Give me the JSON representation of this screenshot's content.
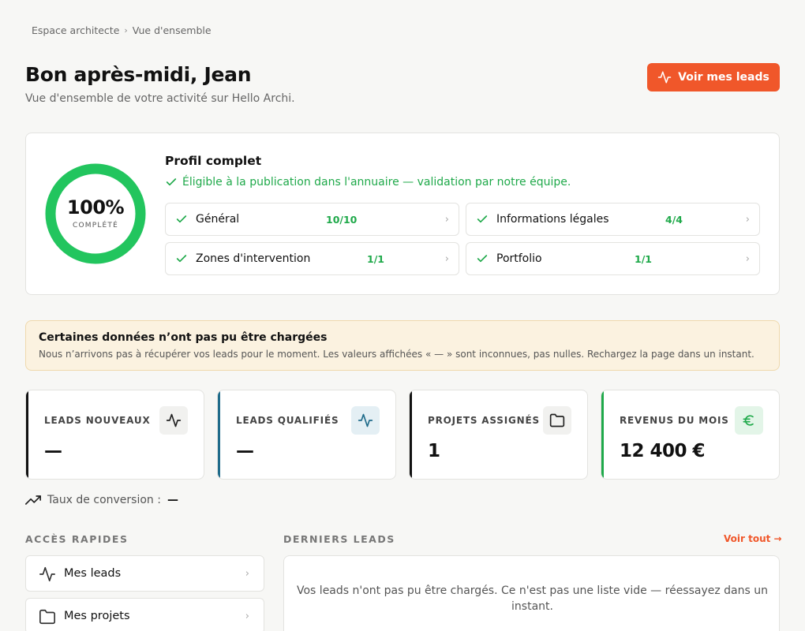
{
  "breadcrumb": {
    "items": [
      "Espace architecte",
      "Vue d'ensemble"
    ]
  },
  "header": {
    "title": "Bon après-midi, Jean",
    "subtitle": "Vue d'ensemble de votre activité sur Hello Archi.",
    "cta_label": "Voir mes leads"
  },
  "profile": {
    "progress_percent": 100,
    "percent_label": "100%",
    "percent_caption": "COMPLÉTÉ",
    "title": "Profil complet",
    "status": "Éligible à la publication dans l'annuaire — validation par notre équipe.",
    "sections": [
      {
        "name": "Général",
        "count": "10/10"
      },
      {
        "name": "Informations légales",
        "count": "4/4"
      },
      {
        "name": "Zones d'intervention",
        "count": "1/1"
      },
      {
        "name": "Portfolio",
        "count": "1/1"
      }
    ]
  },
  "warning": {
    "title": "Certaines données n’ont pas pu être chargées",
    "text": "Nous n’arrivons pas à récupérer vos leads pour le moment. Les valeurs affichées « — » sont inconnues, pas nulles. Rechargez la page dans un instant."
  },
  "stats": [
    {
      "label": "LEADS NOUVEAUX",
      "value": "—",
      "icon": "activity-icon",
      "accent": "#111111"
    },
    {
      "label": "LEADS QUALIFIÉS",
      "value": "—",
      "icon": "activity-icon",
      "accent": "#1f6b8a"
    },
    {
      "label": "PROJETS ASSIGNÉS",
      "value": "1",
      "icon": "folder-icon",
      "accent": "#111111"
    },
    {
      "label": "REVENUS DU MOIS",
      "value": "12 400 €",
      "icon": "euro-icon",
      "accent": "#1fa94a"
    }
  ],
  "conversion": {
    "label": "Taux de conversion :",
    "value": "—"
  },
  "quick_access": {
    "title": "ACCÈS RAPIDES",
    "items": [
      {
        "label": "Mes leads",
        "icon": "activity-icon"
      },
      {
        "label": "Mes projets",
        "icon": "folder-icon"
      }
    ]
  },
  "latest_leads": {
    "title": "DERNIERS LEADS",
    "view_all": "Voir tout →",
    "message": "Vos leads n'ont pas pu être chargés. Ce n'est pas une liste vide — réessayez dans un instant."
  },
  "colors": {
    "accent": "#f0572a",
    "success": "#1fa94a",
    "warning_bg": "#fbf2e0",
    "info": "#1f6b8a"
  }
}
